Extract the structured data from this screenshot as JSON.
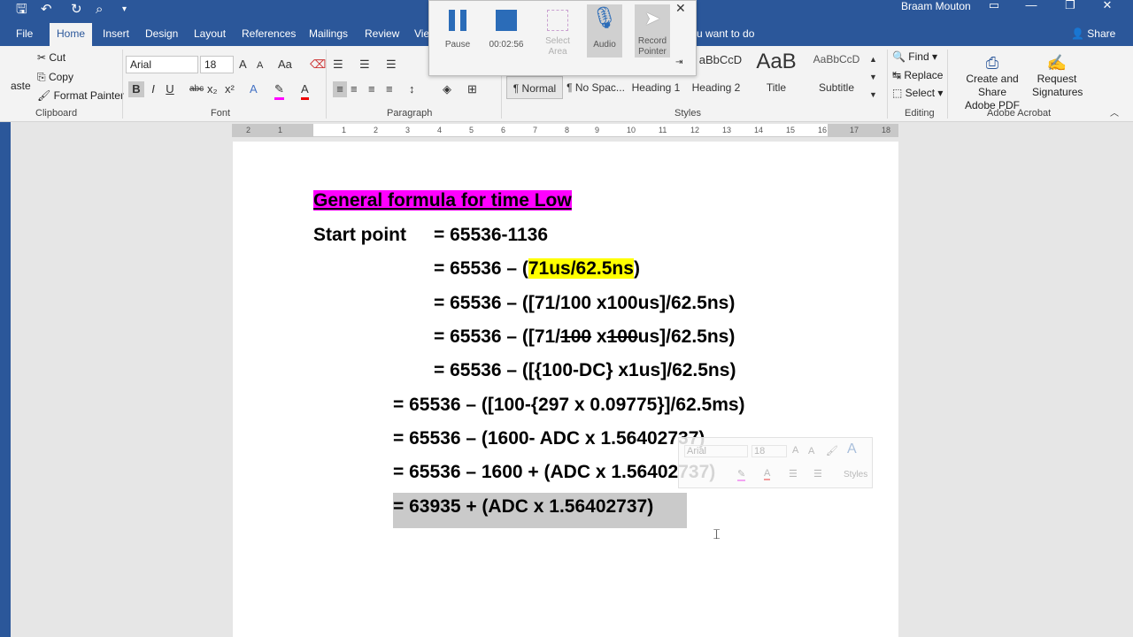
{
  "title_bar": {
    "user": "Braam Mouton",
    "qat_icons": [
      "save-icon",
      "undo-icon",
      "redo-icon",
      "print-preview-icon",
      "customize-qat-icon"
    ],
    "window_controls": [
      "ribbon-display-icon",
      "minimize-icon",
      "restore-icon",
      "close-icon"
    ]
  },
  "tabs": [
    "File",
    "Home",
    "Insert",
    "Design",
    "Layout",
    "References",
    "Mailings",
    "Review",
    "Vie"
  ],
  "active_tab": "Home",
  "tell_me": "u want to do",
  "share": "Share",
  "ribbon": {
    "clipboard": {
      "label": "Clipboard",
      "paste": "aste",
      "cut": "Cut",
      "copy": "Copy",
      "format_painter": "Format Painter"
    },
    "font": {
      "label": "Font",
      "font_name": "Arial",
      "font_size": "18",
      "change_case": "Aa",
      "buttons": [
        "B",
        "I",
        "U",
        "abc",
        "x₂",
        "x²"
      ]
    },
    "paragraph": {
      "label": "Paragraph"
    },
    "styles": {
      "label": "Styles",
      "items": [
        "¶ Normal",
        "¶ No Spac...",
        "Heading 1",
        "Heading 2",
        "Title",
        "Subtitle"
      ],
      "previews": [
        "aBbCcD",
        "AaB",
        "AaBbCcD"
      ]
    },
    "editing": {
      "label": "Editing",
      "find": "Find",
      "replace": "Replace",
      "select": "Select"
    },
    "acrobat": {
      "label": "Adobe Acrobat",
      "create_share_1": "Create and Share",
      "create_share_2": "Adobe PDF",
      "request_1": "Request",
      "request_2": "Signatures"
    }
  },
  "recorder": {
    "pause": "Pause",
    "timer": "00:02:56",
    "select_area_1": "Select",
    "select_area_2": "Area",
    "audio": "Audio",
    "record_pointer_1": "Record",
    "record_pointer_2": "Pointer"
  },
  "ruler": [
    "2",
    "1",
    "1",
    "2",
    "3",
    "4",
    "5",
    "6",
    "7",
    "8",
    "9",
    "10",
    "11",
    "12",
    "13",
    "14",
    "15",
    "16",
    "17",
    "18"
  ],
  "document": {
    "heading": "General formula for time Low",
    "start_label": "Start point",
    "line1": "= 65536-1136",
    "line2_a": "= 65536 – (",
    "line2_hl": "71us/62.5ns",
    "line2_b": ")",
    "line3": "= 65536 – ([71/100 x100us]/62.5ns)",
    "line4_a": "= 65536 – ([71/",
    "line4_s1": "100",
    "line4_b": " x",
    "line4_s2": "100",
    "line4_c": "us]/62.5ns)",
    "line5": "= 65536 – ([{100-DC} x1us]/62.5ns)",
    "line6": "= 65536 – ([100-{297 x 0.09775}]/62.5ms)",
    "line7": "= 65536 – (1600- ADC x 1.56402737)",
    "line8": "= 65536 – 1600 + (ADC x 1.56402737)",
    "line9": "= 63935 + (ADC x 1.56402737)"
  },
  "mini_toolbar": {
    "font": "Arial",
    "size": "18",
    "styles": "Styles"
  }
}
